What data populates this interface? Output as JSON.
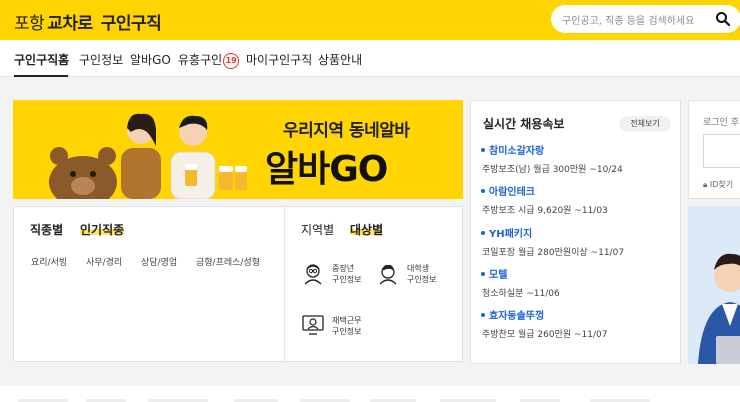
{
  "header": {
    "city": "포항",
    "brand": "교차로",
    "service": "구인구직",
    "search_placeholder": "구인공고, 직종 등을 검색하세요",
    "colors": {
      "accent": "#ffd400",
      "link": "#1f63d6",
      "badge": "#e6332a"
    }
  },
  "nav": {
    "items": [
      {
        "label": "구인구직홈"
      },
      {
        "label": "구인정보"
      },
      {
        "label": "알바GO"
      },
      {
        "label": "유흥구인",
        "badge": "19"
      },
      {
        "label": "마이구인구직"
      },
      {
        "label": "상품안내"
      }
    ]
  },
  "banner": {
    "subtitle": "우리지역 동네알바",
    "title_prefix": "알바",
    "title_suffix": "GO"
  },
  "category": {
    "left_tabs": [
      "직종별",
      "인기직종"
    ],
    "chips": [
      "요리/서빙",
      "사무/경리",
      "상담/영업",
      "금형/프레스/성형"
    ],
    "right_tabs": [
      "지역별",
      "대상별"
    ],
    "targets": [
      {
        "line1": "중장년",
        "line2": "구인정보",
        "icon": "senior-icon"
      },
      {
        "line1": "대학생",
        "line2": "구인정보",
        "icon": "student-icon"
      },
      {
        "line1": "재택근무",
        "line2": "구인정보",
        "icon": "remote-work-icon"
      }
    ]
  },
  "realtime": {
    "title": "실시간 채용속보",
    "view_all": "전체보기",
    "items": [
      {
        "name": "참미소갈자랑",
        "desc": "주방보조(남) 월급 300만원 ~10/24"
      },
      {
        "name": "아람인테크",
        "desc": "주방보조 시급 9,620원 ~11/03"
      },
      {
        "name": "YH패키지",
        "desc": "코일포장 월급 280만원이상 ~11/07"
      },
      {
        "name": "모텔",
        "desc": "청소하실분 ~11/06"
      },
      {
        "name": "효자동솔뚜껑",
        "desc": "주방찬모 월급 260만원 ~11/07"
      }
    ]
  },
  "login": {
    "label": "로그인 후",
    "id_find": "ID찾기"
  }
}
